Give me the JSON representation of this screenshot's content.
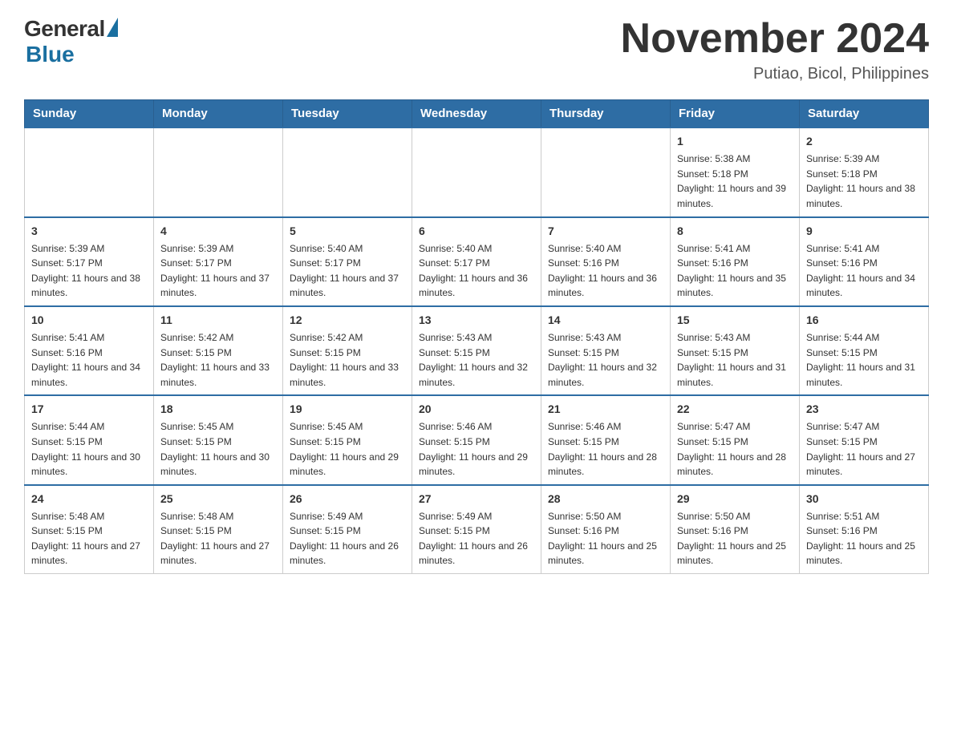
{
  "header": {
    "logo_general": "General",
    "logo_blue": "Blue",
    "month_title": "November 2024",
    "location": "Putiao, Bicol, Philippines"
  },
  "weekdays": [
    "Sunday",
    "Monday",
    "Tuesday",
    "Wednesday",
    "Thursday",
    "Friday",
    "Saturday"
  ],
  "weeks": [
    [
      {
        "day": "",
        "info": ""
      },
      {
        "day": "",
        "info": ""
      },
      {
        "day": "",
        "info": ""
      },
      {
        "day": "",
        "info": ""
      },
      {
        "day": "",
        "info": ""
      },
      {
        "day": "1",
        "info": "Sunrise: 5:38 AM\nSunset: 5:18 PM\nDaylight: 11 hours and 39 minutes."
      },
      {
        "day": "2",
        "info": "Sunrise: 5:39 AM\nSunset: 5:18 PM\nDaylight: 11 hours and 38 minutes."
      }
    ],
    [
      {
        "day": "3",
        "info": "Sunrise: 5:39 AM\nSunset: 5:17 PM\nDaylight: 11 hours and 38 minutes."
      },
      {
        "day": "4",
        "info": "Sunrise: 5:39 AM\nSunset: 5:17 PM\nDaylight: 11 hours and 37 minutes."
      },
      {
        "day": "5",
        "info": "Sunrise: 5:40 AM\nSunset: 5:17 PM\nDaylight: 11 hours and 37 minutes."
      },
      {
        "day": "6",
        "info": "Sunrise: 5:40 AM\nSunset: 5:17 PM\nDaylight: 11 hours and 36 minutes."
      },
      {
        "day": "7",
        "info": "Sunrise: 5:40 AM\nSunset: 5:16 PM\nDaylight: 11 hours and 36 minutes."
      },
      {
        "day": "8",
        "info": "Sunrise: 5:41 AM\nSunset: 5:16 PM\nDaylight: 11 hours and 35 minutes."
      },
      {
        "day": "9",
        "info": "Sunrise: 5:41 AM\nSunset: 5:16 PM\nDaylight: 11 hours and 34 minutes."
      }
    ],
    [
      {
        "day": "10",
        "info": "Sunrise: 5:41 AM\nSunset: 5:16 PM\nDaylight: 11 hours and 34 minutes."
      },
      {
        "day": "11",
        "info": "Sunrise: 5:42 AM\nSunset: 5:15 PM\nDaylight: 11 hours and 33 minutes."
      },
      {
        "day": "12",
        "info": "Sunrise: 5:42 AM\nSunset: 5:15 PM\nDaylight: 11 hours and 33 minutes."
      },
      {
        "day": "13",
        "info": "Sunrise: 5:43 AM\nSunset: 5:15 PM\nDaylight: 11 hours and 32 minutes."
      },
      {
        "day": "14",
        "info": "Sunrise: 5:43 AM\nSunset: 5:15 PM\nDaylight: 11 hours and 32 minutes."
      },
      {
        "day": "15",
        "info": "Sunrise: 5:43 AM\nSunset: 5:15 PM\nDaylight: 11 hours and 31 minutes."
      },
      {
        "day": "16",
        "info": "Sunrise: 5:44 AM\nSunset: 5:15 PM\nDaylight: 11 hours and 31 minutes."
      }
    ],
    [
      {
        "day": "17",
        "info": "Sunrise: 5:44 AM\nSunset: 5:15 PM\nDaylight: 11 hours and 30 minutes."
      },
      {
        "day": "18",
        "info": "Sunrise: 5:45 AM\nSunset: 5:15 PM\nDaylight: 11 hours and 30 minutes."
      },
      {
        "day": "19",
        "info": "Sunrise: 5:45 AM\nSunset: 5:15 PM\nDaylight: 11 hours and 29 minutes."
      },
      {
        "day": "20",
        "info": "Sunrise: 5:46 AM\nSunset: 5:15 PM\nDaylight: 11 hours and 29 minutes."
      },
      {
        "day": "21",
        "info": "Sunrise: 5:46 AM\nSunset: 5:15 PM\nDaylight: 11 hours and 28 minutes."
      },
      {
        "day": "22",
        "info": "Sunrise: 5:47 AM\nSunset: 5:15 PM\nDaylight: 11 hours and 28 minutes."
      },
      {
        "day": "23",
        "info": "Sunrise: 5:47 AM\nSunset: 5:15 PM\nDaylight: 11 hours and 27 minutes."
      }
    ],
    [
      {
        "day": "24",
        "info": "Sunrise: 5:48 AM\nSunset: 5:15 PM\nDaylight: 11 hours and 27 minutes."
      },
      {
        "day": "25",
        "info": "Sunrise: 5:48 AM\nSunset: 5:15 PM\nDaylight: 11 hours and 27 minutes."
      },
      {
        "day": "26",
        "info": "Sunrise: 5:49 AM\nSunset: 5:15 PM\nDaylight: 11 hours and 26 minutes."
      },
      {
        "day": "27",
        "info": "Sunrise: 5:49 AM\nSunset: 5:15 PM\nDaylight: 11 hours and 26 minutes."
      },
      {
        "day": "28",
        "info": "Sunrise: 5:50 AM\nSunset: 5:16 PM\nDaylight: 11 hours and 25 minutes."
      },
      {
        "day": "29",
        "info": "Sunrise: 5:50 AM\nSunset: 5:16 PM\nDaylight: 11 hours and 25 minutes."
      },
      {
        "day": "30",
        "info": "Sunrise: 5:51 AM\nSunset: 5:16 PM\nDaylight: 11 hours and 25 minutes."
      }
    ]
  ]
}
